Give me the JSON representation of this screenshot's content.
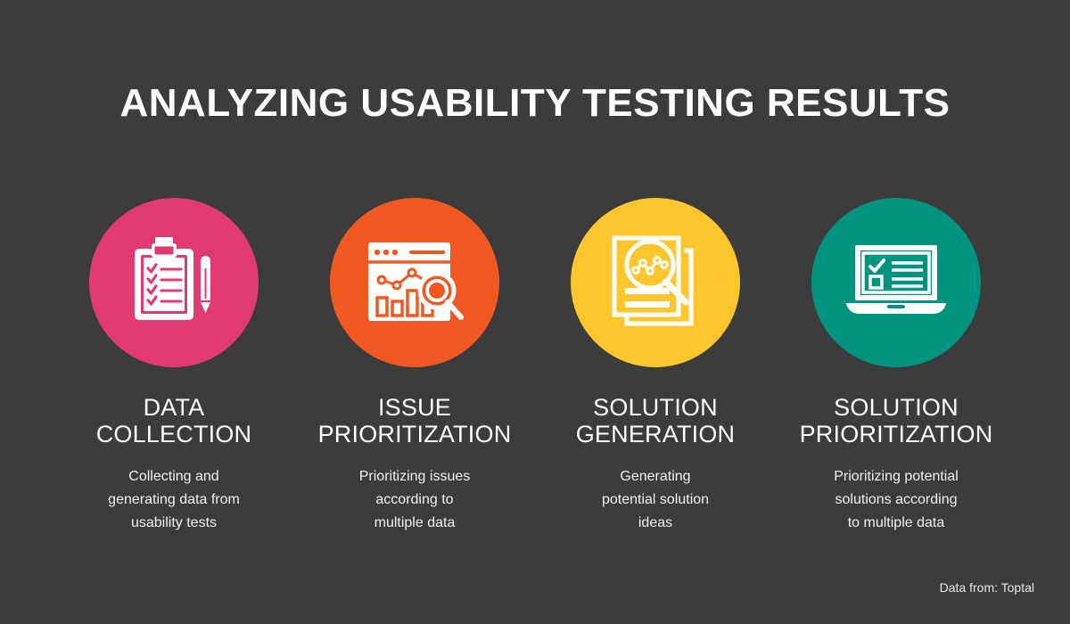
{
  "background_color": "#3c3c3c",
  "header": {
    "title": "ANALYZING USABILITY TESTING RESULTS",
    "title_color": "#ffffff"
  },
  "steps": [
    {
      "icon": "clipboard-checklist-pencil-icon",
      "circle_color": "#e13a70",
      "title": "DATA\nCOLLECTION",
      "description": "Collecting and\ngenerating data from\nusability tests"
    },
    {
      "icon": "browser-analytics-magnifier-icon",
      "circle_color": "#f25822",
      "title": "ISSUE\nPRIORITIZATION",
      "description": "Prioritizing issues\naccording to\nmultiple data"
    },
    {
      "icon": "documents-magnifier-chart-icon",
      "circle_color": "#fcc62c",
      "title": "SOLUTION\nGENERATION",
      "description": "Generating\npotential solution\nideas"
    },
    {
      "icon": "laptop-checklist-icon",
      "circle_color": "#009480",
      "title": "SOLUTION\nPRIORITIZATION",
      "description": "Prioritizing potential\nsolutions according\nto multiple data"
    }
  ],
  "footer": {
    "attribution": "Data from: Toptal"
  }
}
